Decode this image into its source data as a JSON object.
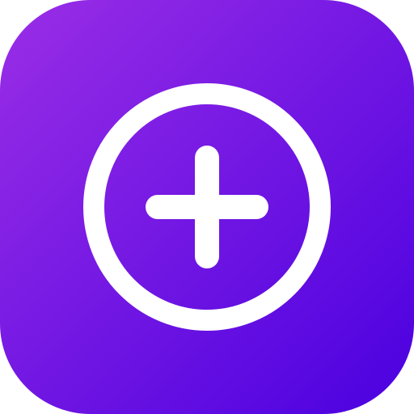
{
  "icon": {
    "name": "add-circle-icon",
    "background_gradient": {
      "start": "#9a2ee6",
      "end": "#4a00e0"
    },
    "glyph_color": "#ffffff"
  }
}
